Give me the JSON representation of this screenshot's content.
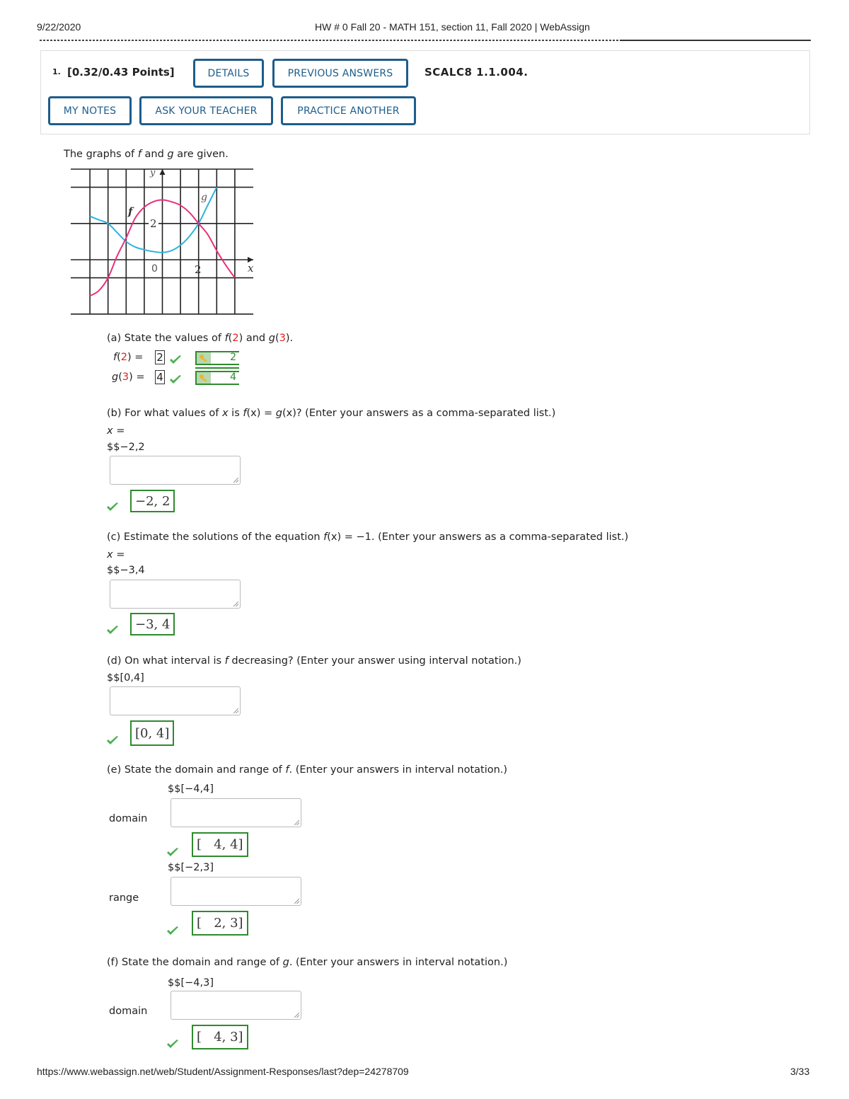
{
  "page_header": {
    "date": "9/22/2020",
    "title": "HW # 0 Fall 20 - MATH 151, section 11, Fall 2020 | WebAssign"
  },
  "page_footer": {
    "url": "https://www.webassign.net/web/Student/Assignment-Responses/last?dep=24278709",
    "page": "3/33"
  },
  "question": {
    "number": "1.",
    "points": "[0.32/0.43 Points]",
    "code": "SCALC8 1.1.004.",
    "buttons": {
      "details": "DETAILS",
      "previous_answers": "PREVIOUS ANSWERS",
      "my_notes": "MY NOTES",
      "ask_teacher": "ASK YOUR TEACHER",
      "practice_another": "PRACTICE ANOTHER"
    },
    "accent_color": "#1d5d8c",
    "intro": {
      "pre": "The graphs of ",
      "f": "f",
      "mid": " and ",
      "g": "g",
      "post": " are given."
    }
  },
  "graph": {
    "axis_labels": {
      "x": "x",
      "y": "y"
    },
    "tick_labels": {
      "origin": "0",
      "x_two": "2",
      "y_two": "2"
    },
    "curve_labels": {
      "f": "f",
      "g": "g"
    },
    "colors": {
      "f": "#e8307a",
      "g": "#2bb3e0"
    },
    "x_range": [
      -4,
      5
    ],
    "y_range": [
      -3,
      5
    ],
    "f_points": [
      [
        -4,
        -2
      ],
      [
        -3.5,
        -1.7
      ],
      [
        -3,
        -1
      ],
      [
        -2.5,
        0.2
      ],
      [
        -2,
        1.2
      ],
      [
        -1.5,
        2.3
      ],
      [
        -1,
        2.9
      ],
      [
        -0.5,
        3.2
      ],
      [
        0,
        3.3
      ],
      [
        0.5,
        3.2
      ],
      [
        1,
        3
      ],
      [
        1.5,
        2.6
      ],
      [
        2,
        2
      ],
      [
        2.5,
        1.4
      ],
      [
        3,
        0.5
      ],
      [
        3.5,
        -0.3
      ],
      [
        4,
        -1
      ]
    ],
    "g_points": [
      [
        -4,
        2.4
      ],
      [
        -3.5,
        2.2
      ],
      [
        -3,
        2
      ],
      [
        -2.5,
        1.5
      ],
      [
        -2,
        1
      ],
      [
        -1.5,
        0.7
      ],
      [
        -1,
        0.55
      ],
      [
        -0.5,
        0.45
      ],
      [
        0,
        0.4
      ],
      [
        0.5,
        0.5
      ],
      [
        1,
        0.8
      ],
      [
        1.5,
        1.3
      ],
      [
        2,
        2
      ],
      [
        2.5,
        3
      ],
      [
        3,
        4
      ]
    ]
  },
  "part_a": {
    "prompt_pre": "(a) State the values of ",
    "f_call": "f",
    "f_arg": "2",
    "and": " and ",
    "g_call": "g",
    "g_arg": "3",
    "prompt_post": ").",
    "row_f": {
      "fn": "f",
      "arg": "2",
      "eq": ") =",
      "answer": "2",
      "key_answer": "2"
    },
    "row_g": {
      "fn": "g",
      "arg": "3",
      "eq": ") =",
      "answer": "4",
      "key_answer": "4"
    }
  },
  "part_b": {
    "prompt_pre": "(b) For what values of ",
    "x": "x",
    "is": " is ",
    "fx": "f",
    "eq": "(x) = ",
    "gx": "g",
    "prompt_post": "(x)? (Enter your answers as a comma-separated list.)",
    "x_eq": "x =",
    "raw": "$$−2,2",
    "input_value": "",
    "correct_display": "−2, 2"
  },
  "part_c": {
    "prompt_pre": "(c) Estimate the solutions of the equation ",
    "fx": "f",
    "prompt_post": "(x) = −1. (Enter your answers as a comma-separated list.)",
    "x_eq": "x =",
    "raw": "$$−3,4",
    "input_value": "",
    "correct_display": "−3, 4"
  },
  "part_d": {
    "prompt_pre": "(d) On what interval is ",
    "f": "f",
    "prompt_post": " decreasing? (Enter your answer using interval notation.)",
    "raw": "$$[0,4]",
    "input_value": "",
    "correct_display": "[0, 4]"
  },
  "part_e": {
    "prompt_pre": "(e) State the domain and range of ",
    "f": "f",
    "prompt_post": ". (Enter your answers in interval notation.)",
    "domain_label": "domain",
    "domain_raw": "$$[−4,4]",
    "domain_input": "",
    "domain_display": "[   4, 4]",
    "range_label": "range",
    "range_raw": "$$[−2,3]",
    "range_input": "",
    "range_display": "[   2, 3]"
  },
  "part_f": {
    "prompt_pre": "(f) State the domain and range of ",
    "g": "g",
    "prompt_post": ". (Enter your answers in interval notation.)",
    "domain_label": "domain",
    "domain_raw": "$$[−4,3]",
    "domain_input": "",
    "domain_display": "[   4, 3]"
  },
  "status_colors": {
    "correct": "#2e8b2e",
    "check": "#4caf50"
  }
}
